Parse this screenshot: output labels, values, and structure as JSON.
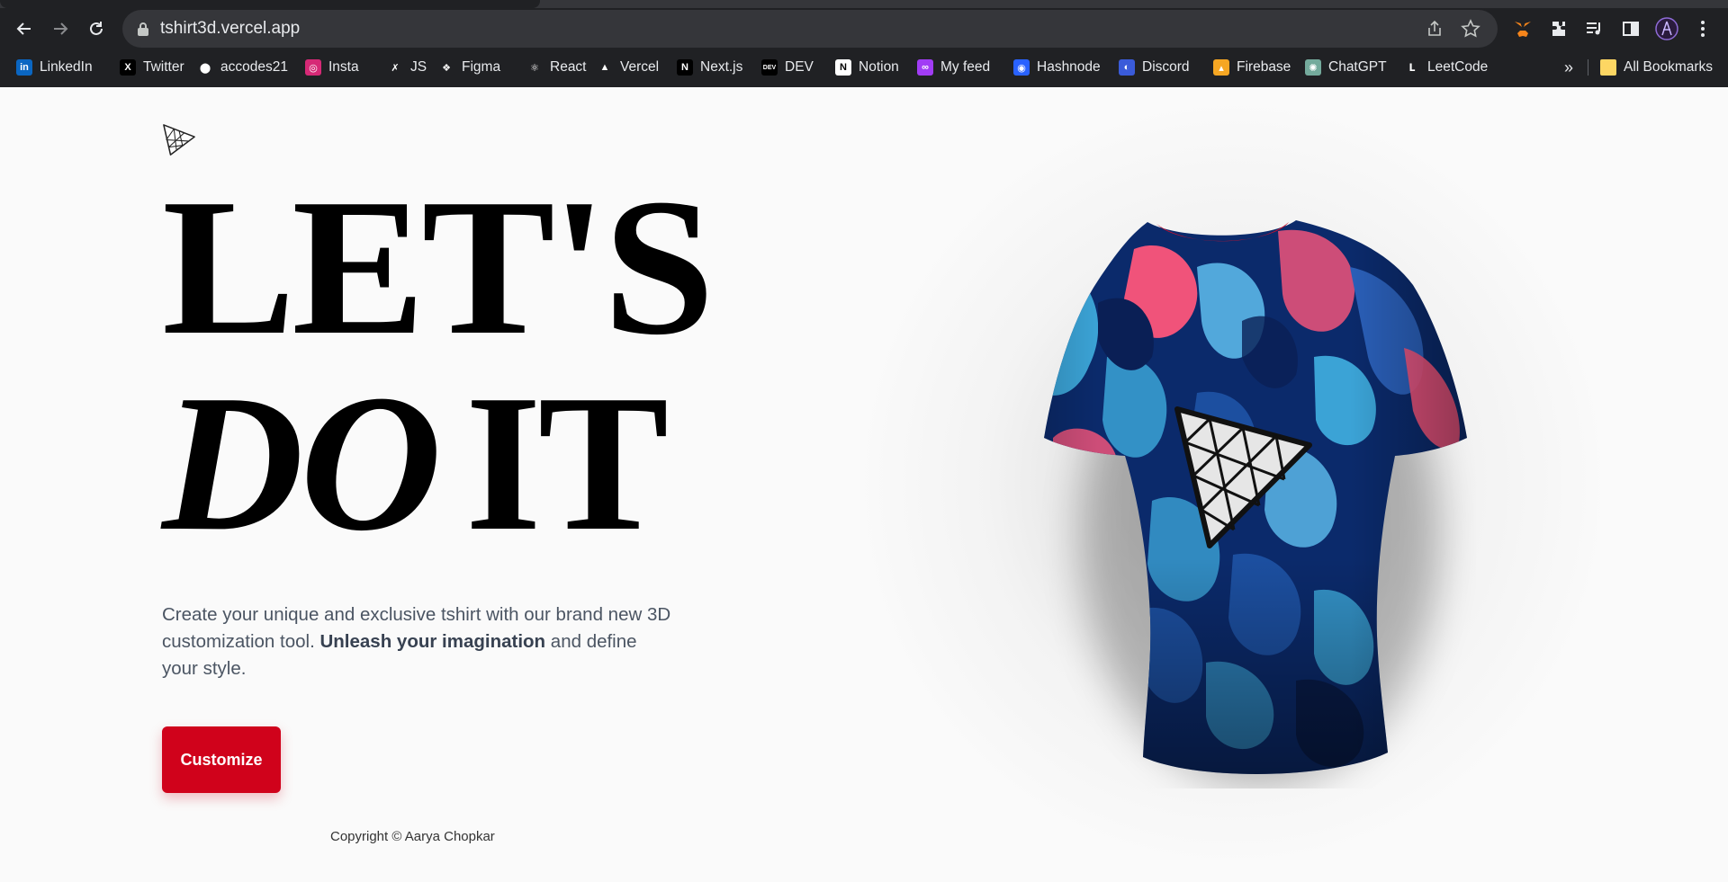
{
  "browser": {
    "url": "tshirt3d.vercel.app",
    "bookmarks": [
      {
        "label": "LinkedIn",
        "icon": "linkedin-icon",
        "color": "#0a66c2",
        "glyph": "in"
      },
      {
        "label": "Twitter",
        "icon": "x-icon",
        "color": "#000000",
        "glyph": "X"
      },
      {
        "label": "accodes21",
        "icon": "github-icon",
        "color": "#202124",
        "glyph": "⬤"
      },
      {
        "label": "Insta",
        "icon": "instagram-icon",
        "color": "#d62976",
        "glyph": "◎"
      },
      {
        "label": "JS",
        "icon": "js-icon",
        "color": "#202124",
        "glyph": "✗"
      },
      {
        "label": "Figma",
        "icon": "figma-icon",
        "color": "#202124",
        "glyph": "❖"
      },
      {
        "label": "React",
        "icon": "react-icon",
        "color": "#202124",
        "glyph": "⚛"
      },
      {
        "label": "Vercel",
        "icon": "vercel-icon",
        "color": "#202124",
        "glyph": "▲"
      },
      {
        "label": "Next.js",
        "icon": "nextjs-icon",
        "color": "#000000",
        "glyph": "N"
      },
      {
        "label": "DEV",
        "icon": "dev-icon",
        "color": "#000000",
        "glyph": "DEV"
      },
      {
        "label": "Notion",
        "icon": "notion-icon",
        "color": "#ffffff",
        "glyph": "N"
      },
      {
        "label": "My feed",
        "icon": "daily-dev-icon",
        "color": "#a13cf5",
        "glyph": "∞"
      },
      {
        "label": "Hashnode",
        "icon": "hashnode-icon",
        "color": "#2962ff",
        "glyph": "◉"
      },
      {
        "label": "Discord",
        "icon": "discord-icon",
        "color": "#3a5bd9",
        "glyph": "◐"
      },
      {
        "label": "Firebase",
        "icon": "firebase-icon",
        "color": "#f5a623",
        "glyph": "▴"
      },
      {
        "label": "ChatGPT",
        "icon": "chatgpt-icon",
        "color": "#74aa9c",
        "glyph": "✺"
      },
      {
        "label": "LeetCode",
        "icon": "leetcode-icon",
        "color": "#202124",
        "glyph": "ᒪ"
      }
    ],
    "overflow_label": "»",
    "all_bookmarks_label": "All Bookmarks"
  },
  "page": {
    "headline_line1": "LET'S",
    "headline_italic": "DO",
    "headline_rest": "IT",
    "description_start": "Create your unique and exclusive tshirt with our brand new 3D customization tool. ",
    "description_bold": "Unleash your imagination",
    "description_end": " and define your style.",
    "cta_label": "Customize",
    "copyright": "Copyright © Aarya Chopkar"
  },
  "colors": {
    "accent": "#d0021b",
    "shirt_base": "#0b2a6b",
    "shirt_light": "#3ba3d6",
    "shirt_pink": "#f0537a"
  }
}
